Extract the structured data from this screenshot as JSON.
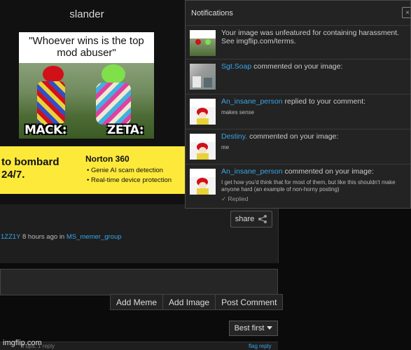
{
  "post": {
    "title": "slander",
    "meme_caption": "\"Whoever wins is the top mod abuser\"",
    "meme_label_left": "MACK:",
    "meme_label_right": "ZETA:"
  },
  "ad": {
    "headline": "to bombard 24/7.",
    "brand": "Norton 360",
    "features": [
      "Genie AI scam detection",
      "Real-time device protection"
    ]
  },
  "share": {
    "label": "share"
  },
  "meta": {
    "author": "1ZZ1Y",
    "time": "8 hours ago",
    "in_label": "in",
    "stream": "MS_memer_group"
  },
  "comment_actions": [
    "Add Meme",
    "Add Image",
    "Post Comment"
  ],
  "sort": {
    "selected": "Best first"
  },
  "footer": {
    "watermark": "imgflip.com",
    "comment_mini": "3 ups, 1 reply",
    "flag_reply": "flag reply"
  },
  "notifications": {
    "header": "Notifications",
    "close_glyph": "×",
    "items": [
      {
        "message": "Your image was unfeatured for containing harassment. See imgflip.com/terms.",
        "line1": "Your image was unfeatured for containing harassment.",
        "line2": "See imgflip.com/terms."
      },
      {
        "user": "Sgt.Soap",
        "action": "commented on your image:"
      },
      {
        "user": "An_insane_person",
        "action": "replied to your comment:",
        "text": "makes sense"
      },
      {
        "user": "Destiny.",
        "action": "commented on your image:",
        "text": "me"
      },
      {
        "user": "An_insane_person",
        "action": "commented on your image:",
        "text_line1": "I get how you'd think that for most of them, but like this shouldn't make",
        "text_line2": "anyone hard (an example of non-horny posting)",
        "status": "✓ Replied"
      }
    ]
  },
  "colors": {
    "accent_link": "#37a6e8",
    "ad_background": "#fde93a",
    "panel_background": "#232323"
  },
  "icons": {
    "share": "share-icon",
    "dropdown": "caret-down-icon",
    "close": "close-icon"
  }
}
